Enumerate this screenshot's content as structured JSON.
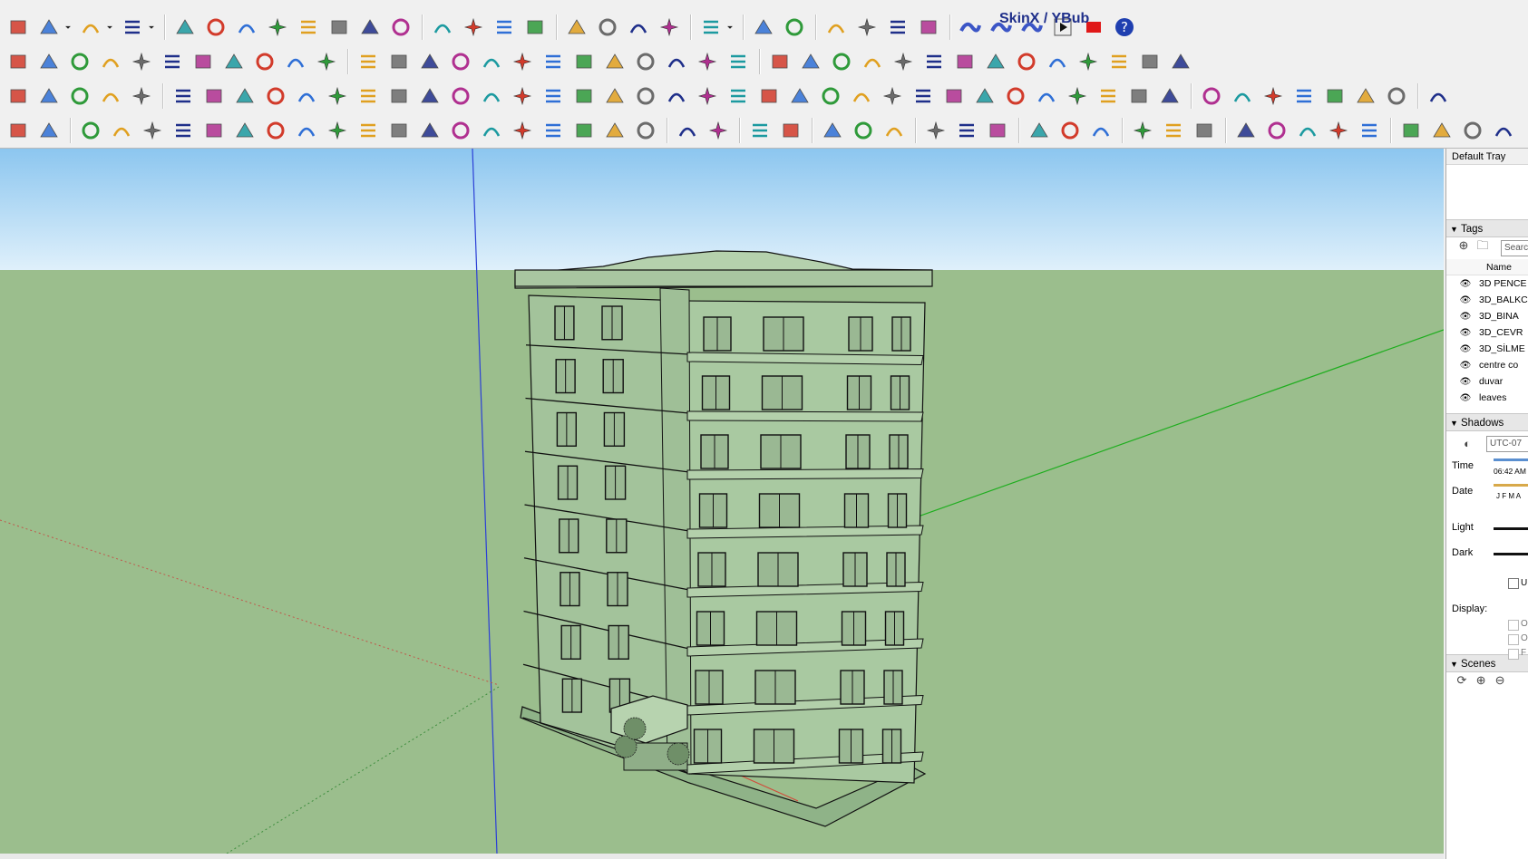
{
  "skinx": {
    "label": "SkinX / YBub"
  },
  "tray": {
    "title": "Default Tray",
    "tags": {
      "header": "Tags",
      "search_placeholder": "Searc",
      "column_name": "Name",
      "items": [
        "3D PENCE",
        "3D_BALKC",
        "3D_BINA",
        "3D_CEVR",
        "3D_SİLME",
        "centre co",
        "duvar",
        "leaves"
      ]
    },
    "shadows": {
      "header": "Shadows",
      "timezone": "UTC-07",
      "time_label": "Time",
      "time_value": "06:42 AM",
      "date_label": "Date",
      "date_months": "J F M A",
      "light_label": "Light",
      "dark_label": "Dark",
      "use_sun_checkbox": "U",
      "display_label": "Display:",
      "display_opt_1": "O",
      "display_opt_2": "O",
      "display_opt_3": "F"
    },
    "scenes": {
      "header": "Scenes"
    }
  },
  "colors": {
    "sky_top": "#8cc6ef",
    "sky_bottom": "#dff0fb",
    "ground": "#9bbe8d",
    "building": "#a3c39b",
    "axis_blue": "#2b3fd6",
    "axis_green": "#1fae1f",
    "axis_red": "#d14b3b"
  },
  "icons": {
    "row1": [
      "eraser-icon",
      "pencil-icon",
      "dropdown-arrow-icon",
      "arc-icon",
      "dropdown-arrow-icon",
      "rectangle-icon",
      "dropdown-arrow-icon",
      "push-pull-icon",
      "follow-me-icon",
      "move-icon",
      "rotate-icon",
      "scale-icon",
      "tape-measure-icon",
      "text-icon",
      "paint-bucket-icon",
      "orbit-icon",
      "pan-icon",
      "zoom-icon",
      "zoom-extents-icon",
      "warehouse-icon",
      "layers-icon",
      "layers-stack-icon",
      "layers-settings-icon",
      "user-icon",
      "dropdown-arrow-icon",
      "map-icon",
      "tag-icon",
      "sandbox-icon",
      "sandbox2-icon",
      "solid-tools-icon",
      "globe-icon",
      "skinx-wave-icon",
      "skinx-wave-icon",
      "skinx-wave-icon",
      "play-icon",
      "stop-icon",
      "help-icon"
    ],
    "row2": [
      "bezier-icon",
      "curve-icon",
      "split-icon",
      "round-corner-icon",
      "path-icon",
      "sweep-icon",
      "box-icon",
      "sphere-icon",
      "loft-icon",
      "offset-icon",
      "fillet-icon",
      "extend-icon",
      "bend-icon",
      "shell-icon",
      "cut-icon",
      "array-icon",
      "grid-icon",
      "hand-icon",
      "surface-icon",
      "fold-icon",
      "stair-icon",
      "slice-icon",
      "line-tools-icon",
      "split-line-icon",
      "join-line-icon",
      "road-icon",
      "hatch-icon",
      "face-icon",
      "music-icon",
      "fence-icon",
      "hatch2-icon",
      "wall-icon",
      "pillars-icon",
      "tube-icon",
      "divide-icon",
      "stripes-icon",
      "lines-icon",
      "house-icon"
    ],
    "row3": [
      "plane-blue-icon",
      "plane-yellow-icon",
      "plane-green-icon",
      "plane-red-icon",
      "plane-white-icon",
      "spiral-icon",
      "square-red-icon",
      "frame-icon",
      "flag-icon",
      "block-icon",
      "chain-icon",
      "curve2-icon",
      "dots-icon",
      "plus-red-icon",
      "plus-green-icon",
      "cross-blue-icon",
      "cone-icon",
      "pyramid-icon",
      "triangle-icon",
      "hook-icon",
      "arc2-icon",
      "loop-icon",
      "arrows-icon",
      "bucket-icon",
      "undo-red-icon",
      "tree-icon",
      "cube-arrow-icon",
      "cube-red-icon",
      "cubes-icon",
      "gem-icon",
      "puzzle-icon",
      "frame2-icon",
      "grid-orange-icon",
      "grid-orange2-icon",
      "grid-orange3-icon",
      "move-dots-icon",
      "circle-dots-icon",
      "grid-arrows-icon",
      "ruler-icon",
      "post-icon",
      "paint-roller-icon",
      "brush-orange-icon",
      "cube-blue-icon",
      "tile-blue-icon",
      "wave-gray-icon",
      "scale-balance-icon"
    ],
    "row4": [
      "fire-icon",
      "cage-icon",
      "arc-blue-icon",
      "zigzag-icon",
      "twist-icon",
      "n-curve-icon",
      "squiggle-icon",
      "round-arc-icon",
      "square-outline-icon",
      "spiral2-icon",
      "arc3-icon",
      "wave-icon",
      "arc4-icon",
      "arc5-icon",
      "arc-red-icon",
      "wave2-icon",
      "circle-gray-icon",
      "wrench-icon",
      "circle-red-icon",
      "triangle-red-icon",
      "layer-green-icon",
      "star-green-icon",
      "select-arrow-icon",
      "resize-icon",
      "resize2-icon",
      "lines-equal-icon",
      "lines-plus-icon",
      "lines-minus-icon",
      "line-split-icon",
      "line-plus-icon",
      "line-minus-icon",
      "box-x-icon",
      "box-grid-icon",
      "box-red-icon",
      "window-icon",
      "window-blue-icon",
      "window-x-icon",
      "table-icon",
      "brick-icon",
      "dome-icon",
      "checker-icon",
      "copy-icon",
      "shuffle-icon",
      "split-frame-icon",
      "panel-icon",
      "panel2-icon"
    ]
  }
}
